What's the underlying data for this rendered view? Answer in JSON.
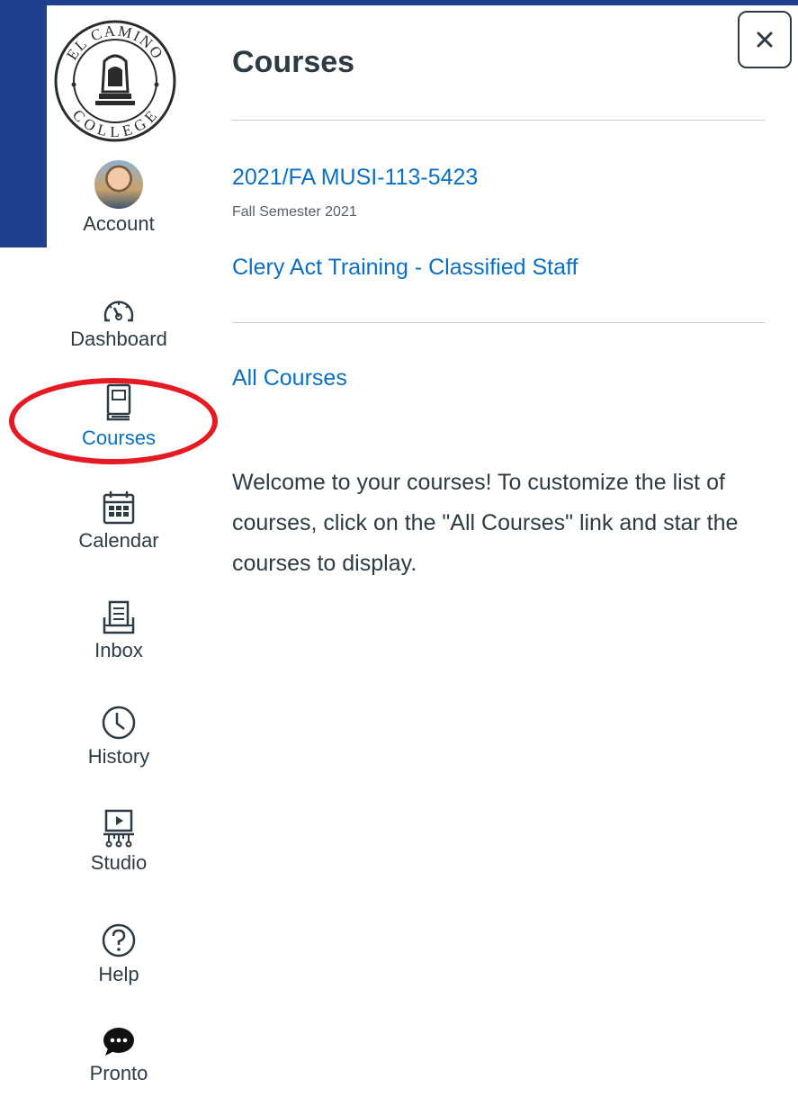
{
  "tray": {
    "title": "Courses",
    "close_label": "×",
    "courses": [
      {
        "name": "2021/FA MUSI-113-5423",
        "term": "Fall Semester 2021"
      },
      {
        "name": "Clery Act Training - Classified Staff"
      }
    ],
    "all_courses_label": "All Courses",
    "welcome_text": "Welcome to your courses! To customize the list of courses, click on the \"All Courses\" link and star the courses to display."
  },
  "logo": {
    "top_text": "EL CAMINO",
    "bottom_text": "COLLEGE"
  },
  "sidebar": {
    "items": [
      {
        "label": "Account",
        "icon": "avatar"
      },
      {
        "label": "Dashboard",
        "icon": "dashboard-icon"
      },
      {
        "label": "Courses",
        "icon": "courses-icon",
        "active": true
      },
      {
        "label": "Calendar",
        "icon": "calendar-icon"
      },
      {
        "label": "Inbox",
        "icon": "inbox-icon"
      },
      {
        "label": "History",
        "icon": "history-icon"
      },
      {
        "label": "Studio",
        "icon": "studio-icon"
      },
      {
        "label": "Help",
        "icon": "help-icon"
      },
      {
        "label": "Pronto",
        "icon": "pronto-icon"
      }
    ]
  },
  "colors": {
    "brand_blue": "#1f3f8f",
    "link": "#0b6fc2",
    "highlight": "#e51b23",
    "text": "#2d3b45"
  }
}
